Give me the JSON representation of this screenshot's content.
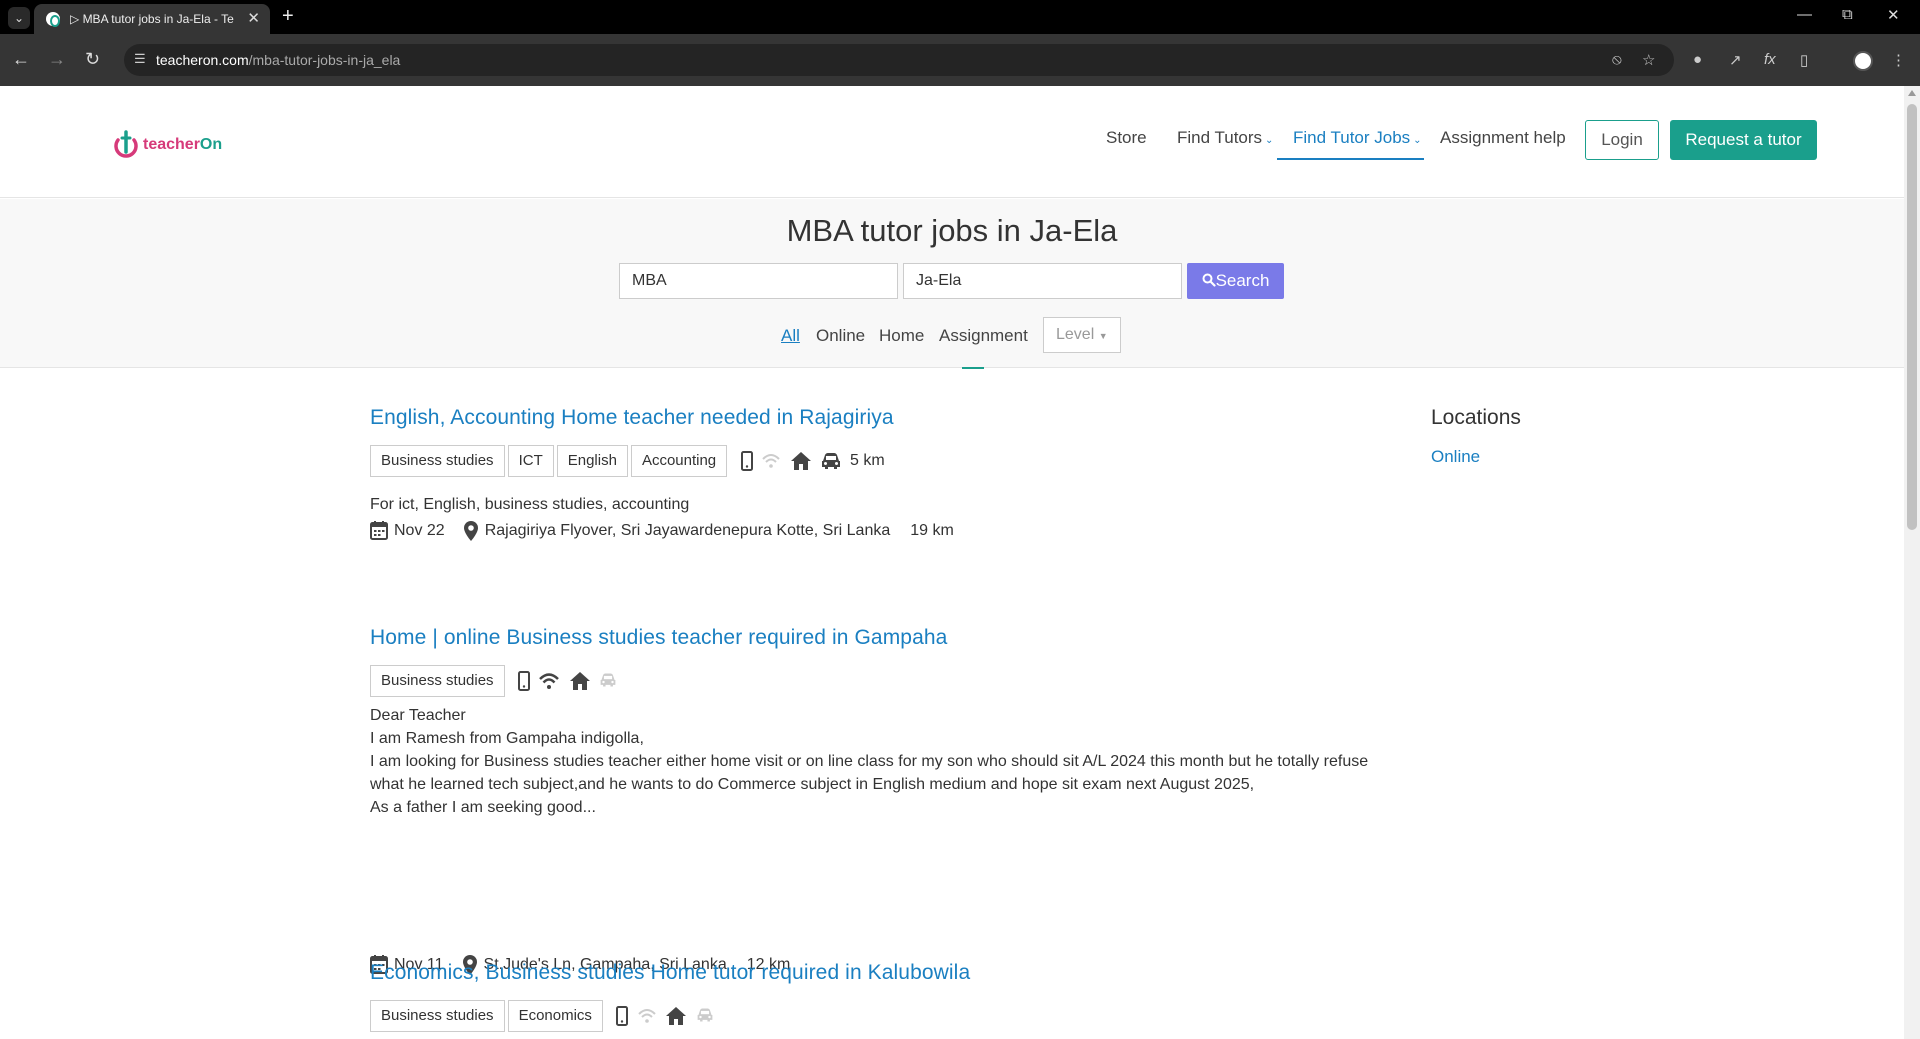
{
  "browser": {
    "tab_title": "▷ MBA tutor jobs in Ja-Ela - Te",
    "url_host": "teacheron.com",
    "url_path": "/mba-tutor-jobs-in-ja_ela"
  },
  "header": {
    "logo_teacher": "teacher",
    "logo_on": "On",
    "nav": {
      "store": "Store",
      "find_tutors": "Find Tutors",
      "find_tutor_jobs": "Find Tutor Jobs",
      "assignment_help": "Assignment help"
    },
    "login": "Login",
    "request": "Request a tutor"
  },
  "search": {
    "title": "MBA tutor jobs in Ja-Ela",
    "subject_value": "MBA",
    "location_value": "Ja-Ela",
    "button": "Search",
    "filters": {
      "all": "All",
      "online": "Online",
      "home": "Home",
      "assignment": "Assignment",
      "level": "Level"
    }
  },
  "jobs": [
    {
      "title": "English, Accounting Home teacher needed in Rajagiriya",
      "tags": [
        "Business studies",
        "ICT",
        "English",
        "Accounting"
      ],
      "modes": {
        "phone": true,
        "online": false,
        "home": true,
        "travel": true
      },
      "travel_distance": "5 km",
      "description": "For ict, English, business studies, accounting",
      "date": "Nov 22",
      "location": "Rajagiriya Flyover, Sri Jayawardenepura Kotte, Sri Lanka",
      "distance": "19 km"
    },
    {
      "title": "Home | online Business studies teacher required in Gampaha",
      "tags": [
        "Business studies"
      ],
      "modes": {
        "phone": true,
        "online": true,
        "home": true,
        "travel": false
      },
      "description_lines": [
        "Dear Teacher",
        "I am Ramesh from Gampaha indigolla,",
        "I am looking for Business studies teacher either home visit or on line class for my son who should sit A/L 2024 this month but he totally refuse what he learned tech subject,and he wants to do Commerce subject in English medium and hope sit exam next August 2025,",
        "As a father I am seeking good..."
      ],
      "date": "Nov 11",
      "location": "St.Jude's Ln, Gampaha, Sri Lanka",
      "distance": "12 km"
    },
    {
      "title": "Economics, Business studies Home tutor required in Kalubowila",
      "tags": [
        "Business studies",
        "Economics"
      ],
      "modes": {
        "phone": true,
        "online": false,
        "home": true,
        "travel": false
      }
    }
  ],
  "sidebar": {
    "title": "Locations",
    "online": "Online"
  },
  "colors": {
    "link": "#1a7fc1",
    "brand_green": "#1a9f8c",
    "search_button": "#7a7ae8",
    "icon_active": "#444444",
    "icon_inactive": "#cccccc"
  }
}
